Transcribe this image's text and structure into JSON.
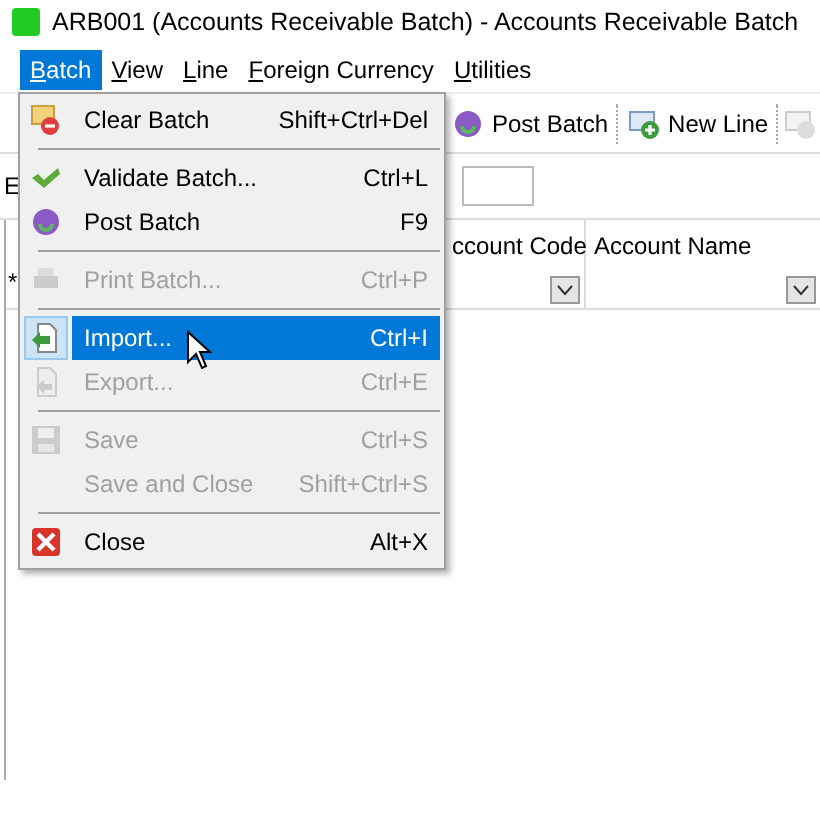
{
  "window": {
    "title": "ARB001 (Accounts Receivable Batch) - Accounts Receivable Batch"
  },
  "menu_bar": [
    {
      "label": "Batch",
      "selected": true
    },
    {
      "label": "View",
      "selected": false
    },
    {
      "label": "Line",
      "selected": false
    },
    {
      "label": "Foreign Currency",
      "selected": false
    },
    {
      "label": "Utilities",
      "selected": false
    }
  ],
  "toolbar": [
    {
      "label": "Post Batch",
      "kind": "post"
    },
    {
      "label": "New Line",
      "kind": "newline"
    },
    {
      "kind": "disabled-icon"
    }
  ],
  "filter": {
    "label": "E"
  },
  "grid": {
    "columns": [
      {
        "label": "ccount Code"
      },
      {
        "label": "Account Name"
      }
    ],
    "row_marker": "*"
  },
  "batch_menu": [
    {
      "kind": "item",
      "label": "Clear Batch",
      "shortcut": "Shift+Ctrl+Del",
      "disabled": false,
      "selected": false
    },
    {
      "kind": "separator"
    },
    {
      "kind": "item",
      "label": "Validate Batch...",
      "shortcut": "Ctrl+L",
      "disabled": false,
      "selected": false
    },
    {
      "kind": "item",
      "label": "Post Batch",
      "shortcut": "F9",
      "disabled": false,
      "selected": false
    },
    {
      "kind": "separator"
    },
    {
      "kind": "item",
      "label": "Print Batch...",
      "shortcut": "Ctrl+P",
      "disabled": true,
      "selected": false
    },
    {
      "kind": "separator"
    },
    {
      "kind": "item",
      "label": "Import...",
      "shortcut": "Ctrl+I",
      "disabled": false,
      "selected": true
    },
    {
      "kind": "item",
      "label": "Export...",
      "shortcut": "Ctrl+E",
      "disabled": true,
      "selected": false
    },
    {
      "kind": "separator"
    },
    {
      "kind": "item",
      "label": "Save",
      "shortcut": "Ctrl+S",
      "disabled": true,
      "selected": false
    },
    {
      "kind": "item",
      "label": "Save and Close",
      "shortcut": "Shift+Ctrl+S",
      "disabled": true,
      "selected": false
    },
    {
      "kind": "separator"
    },
    {
      "kind": "item",
      "label": "Close",
      "shortcut": "Alt+X",
      "disabled": false,
      "selected": false
    }
  ]
}
